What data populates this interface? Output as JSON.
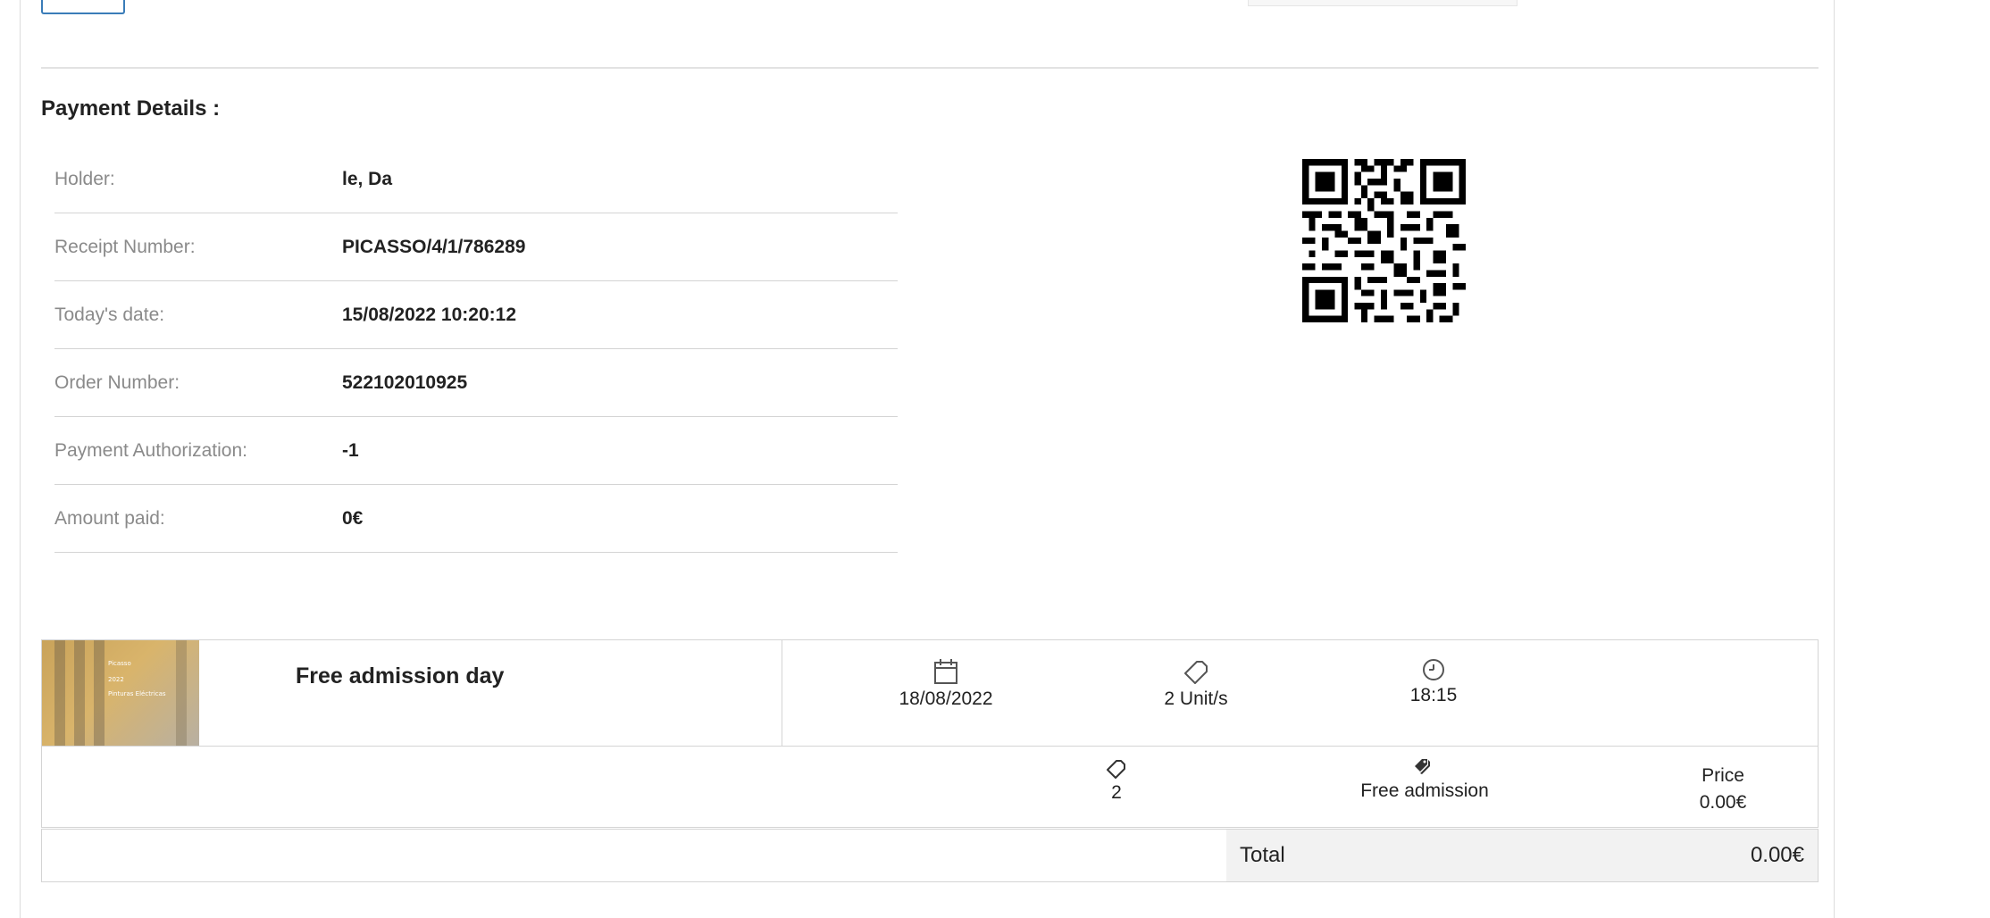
{
  "payment": {
    "title": "Payment Details :",
    "rows": [
      {
        "label": "Holder:",
        "value": "le, Da"
      },
      {
        "label": "Receipt Number:",
        "value": "PICASSO/4/1/786289"
      },
      {
        "label": "Today's date:",
        "value": "15/08/2022 10:20:12"
      },
      {
        "label": "Order Number:",
        "value": "522102010925"
      },
      {
        "label": "Payment Authorization:",
        "value": "-1"
      },
      {
        "label": "Amount paid:",
        "value": "0€"
      }
    ]
  },
  "qr_code": {
    "icon": "qr-code"
  },
  "ticket": {
    "thumbnail_text": [
      "Picasso",
      "2022",
      "Pinturas Eléctricas"
    ],
    "name": "Free admission day",
    "date": "18/08/2022",
    "units": "2 Unit/s",
    "time": "18:15",
    "icons": {
      "date": "calendar-icon",
      "units": "ticket-icon",
      "time": "clock-icon"
    }
  },
  "price_line": {
    "quantity": "2",
    "type": "Free admission",
    "price_label": "Price",
    "price_value": "0.00€",
    "icons": {
      "quantity": "ticket-icon",
      "type": "tags-icon"
    }
  },
  "total": {
    "label": "Total",
    "value": "0.00€"
  }
}
